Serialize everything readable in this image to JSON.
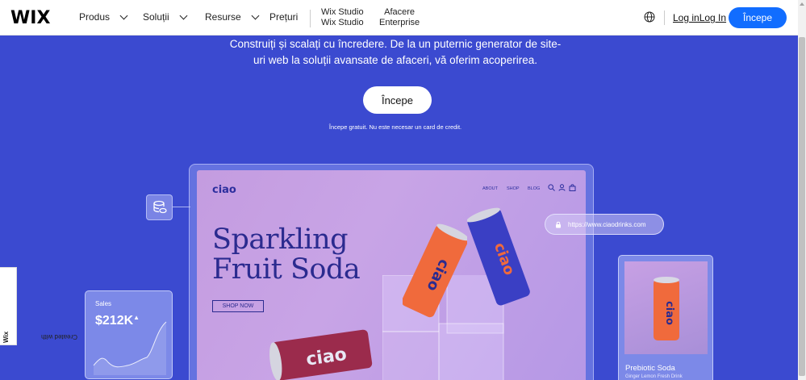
{
  "header": {
    "logo": "WIX",
    "nav": [
      {
        "label": "Produs"
      },
      {
        "label": "Soluții"
      },
      {
        "label": "Resurse"
      },
      {
        "label": "Prețuri"
      }
    ],
    "studio": {
      "line1": "Wix Studio",
      "line2": "Wix Studio"
    },
    "enterprise": {
      "line1": "Afacere",
      "line2": "Enterprise"
    },
    "login": "Log inLog In",
    "start": "Începe"
  },
  "hero": {
    "text": "Construiți și scalați cu încredere. De la un puternic generator de site-uri web la soluții avansate de afaceri, vă oferim acoperirea.",
    "button": "Începe",
    "note": "Începe gratuit. Nu este necesar un card de credit."
  },
  "site": {
    "logo": "ciao",
    "nav": [
      "ABOUT",
      "SHOP",
      "BLOG"
    ],
    "headline_1": "Sparkling",
    "headline_2": "Fruit Soda",
    "shop_button": "SHOP NOW",
    "can_brand": "ciao"
  },
  "url": "https://www.ciaodrinks.com",
  "sales": {
    "label": "Sales",
    "value": "$212K"
  },
  "product": {
    "name": "Prebiotic Soda",
    "sub": "Ginger Lemon Fresh Drink"
  },
  "badge": {
    "prefix": "Created with ",
    "brand": "Wix"
  },
  "colors": {
    "brand_blue": "#116dff",
    "hero_bg": "#3b4ad0",
    "site_ink": "#2b2b8f"
  }
}
